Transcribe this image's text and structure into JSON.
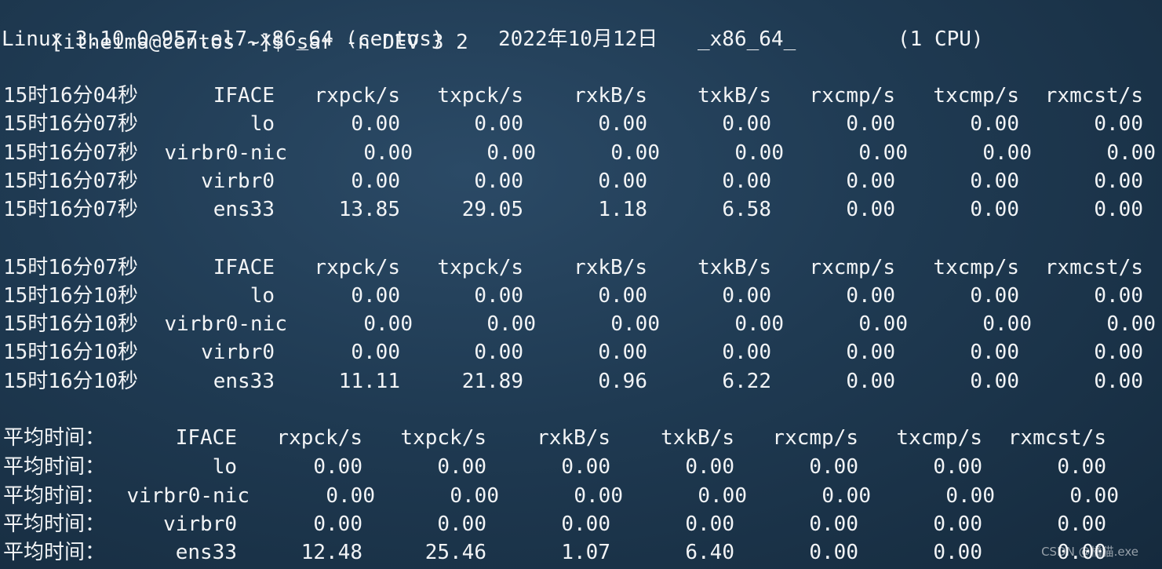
{
  "prompt": "[itheima@centos ~]$ sar -n DEV 3 2",
  "sysinfo": {
    "kernel": "Linux 3.10.0-957.el7.x86_64 (centos)",
    "date": "2022年10月12日",
    "arch": "_x86_64_",
    "cpu": "(1 CPU)"
  },
  "columns": [
    "IFACE",
    "rxpck/s",
    "txpck/s",
    "rxkB/s",
    "txkB/s",
    "rxcmp/s",
    "txcmp/s",
    "rxmcst/s"
  ],
  "blocks": [
    {
      "header_time": "15时16分04秒",
      "rows": [
        {
          "time": "15时16分07秒",
          "iface": "lo",
          "vals": [
            "0.00",
            "0.00",
            "0.00",
            "0.00",
            "0.00",
            "0.00",
            "0.00"
          ]
        },
        {
          "time": "15时16分07秒",
          "iface": "virbr0-nic",
          "vals": [
            "0.00",
            "0.00",
            "0.00",
            "0.00",
            "0.00",
            "0.00",
            "0.00"
          ]
        },
        {
          "time": "15时16分07秒",
          "iface": "virbr0",
          "vals": [
            "0.00",
            "0.00",
            "0.00",
            "0.00",
            "0.00",
            "0.00",
            "0.00"
          ]
        },
        {
          "time": "15时16分07秒",
          "iface": "ens33",
          "vals": [
            "13.85",
            "29.05",
            "1.18",
            "6.58",
            "0.00",
            "0.00",
            "0.00"
          ]
        }
      ]
    },
    {
      "header_time": "15时16分07秒",
      "rows": [
        {
          "time": "15时16分10秒",
          "iface": "lo",
          "vals": [
            "0.00",
            "0.00",
            "0.00",
            "0.00",
            "0.00",
            "0.00",
            "0.00"
          ]
        },
        {
          "time": "15时16分10秒",
          "iface": "virbr0-nic",
          "vals": [
            "0.00",
            "0.00",
            "0.00",
            "0.00",
            "0.00",
            "0.00",
            "0.00"
          ]
        },
        {
          "time": "15时16分10秒",
          "iface": "virbr0",
          "vals": [
            "0.00",
            "0.00",
            "0.00",
            "0.00",
            "0.00",
            "0.00",
            "0.00"
          ]
        },
        {
          "time": "15时16分10秒",
          "iface": "ens33",
          "vals": [
            "11.11",
            "21.89",
            "0.96",
            "6.22",
            "0.00",
            "0.00",
            "0.00"
          ]
        }
      ]
    }
  ],
  "average": {
    "label": "平均时间：",
    "rows": [
      {
        "iface": "lo",
        "vals": [
          "0.00",
          "0.00",
          "0.00",
          "0.00",
          "0.00",
          "0.00",
          "0.00"
        ]
      },
      {
        "iface": "virbr0-nic",
        "vals": [
          "0.00",
          "0.00",
          "0.00",
          "0.00",
          "0.00",
          "0.00",
          "0.00"
        ]
      },
      {
        "iface": "virbr0",
        "vals": [
          "0.00",
          "0.00",
          "0.00",
          "0.00",
          "0.00",
          "0.00",
          "0.00"
        ]
      },
      {
        "iface": "ens33",
        "vals": [
          "12.48",
          "25.46",
          "1.07",
          "6.40",
          "0.00",
          "0.00",
          "0.00"
        ]
      }
    ]
  },
  "watermark": "CSDN @橘猫.exe"
}
